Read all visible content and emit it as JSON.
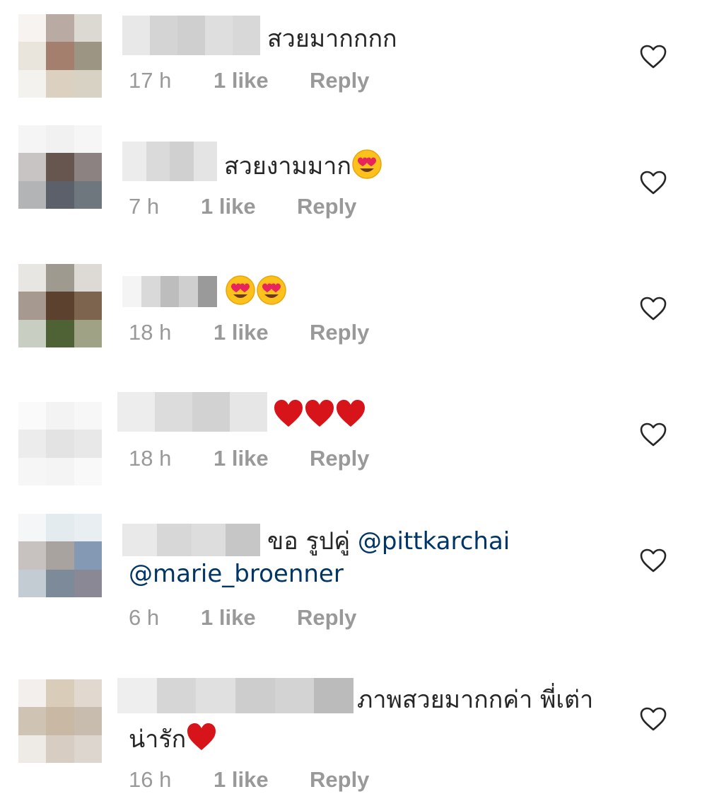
{
  "comments": [
    {
      "text": "สวยมากกกก",
      "time": "17 h",
      "likes": "1 like",
      "reply": "Reply",
      "avatar_colors": [
        "#f6f3f0",
        "#b9aaa3",
        "#dcd8d2",
        "#e9e5dc",
        "#a57f6e",
        "#9d9584",
        "#f4f2ee",
        "#dcd0c0",
        "#d8d2c4"
      ],
      "username_blur": [
        "#e8e8e8",
        "#d4d4d4",
        "#cfcfcf",
        "#dedede",
        "#d8d8d8"
      ]
    },
    {
      "text": "สวยงามมาก",
      "emojis": [
        "heart-eyes-emoji"
      ],
      "time": "7 h",
      "likes": "1 like",
      "reply": "Reply",
      "avatar_colors": [
        "#f5f5f5",
        "#f1f1f1",
        "#f6f6f6",
        "#c9c4c4",
        "#66564f",
        "#8d8282",
        "#b2b4b6",
        "#5c606a",
        "#6f777e"
      ],
      "username_blur": [
        "#ececec",
        "#dadada",
        "#d0d0d0",
        "#e4e4e4"
      ]
    },
    {
      "text": "",
      "emojis": [
        "heart-eyes-emoji",
        "heart-eyes-emoji"
      ],
      "time": "18 h",
      "likes": "1 like",
      "reply": "Reply",
      "avatar_colors": [
        "#e8e6e2",
        "#9f9a90",
        "#ddd9d4",
        "#a69990",
        "#5b412e",
        "#7d644f",
        "#c9cec3",
        "#4f6236",
        "#9fa285"
      ],
      "username_blur": [
        "#f4f4f4",
        "#d9d9d9",
        "#bdbdbd",
        "#cfcfcf",
        "#9a9a9a"
      ]
    },
    {
      "text": "",
      "emojis": [
        "red-heart-emoji",
        "red-heart-emoji",
        "red-heart-emoji"
      ],
      "time": "18 h",
      "likes": "1 like",
      "reply": "Reply",
      "avatar_colors": [
        "#fafafa",
        "#f3f3f3",
        "#f7f7f7",
        "#ececec",
        "#e3e3e3",
        "#e8e8e8",
        "#f6f6f6",
        "#f4f4f4",
        "#f9f9f9"
      ],
      "username_blur": [
        "#ededed",
        "#dcdcdc",
        "#d2d2d2",
        "#e6e6e6"
      ]
    },
    {
      "text": "ขอ รูปคู่ ",
      "mention1": "@pittkarchai",
      "mention2": "@marie_broenner",
      "time": "6 h",
      "likes": "1 like",
      "reply": "Reply",
      "avatar_colors": [
        "#f4f6f7",
        "#e3ebef",
        "#e8eef1",
        "#c7c2bf",
        "#a9a39f",
        "#8499b3",
        "#c4ccd3",
        "#7d8a99",
        "#898894"
      ],
      "username_blur": [
        "#e9e9e9",
        "#d7d7d7",
        "#dddddd",
        "#c6c6c6"
      ]
    },
    {
      "text": "ภาพสวยมากกค่า พี่เต่า",
      "text_line2": "น่ารัก",
      "emojis": [
        "red-heart-emoji"
      ],
      "time": "16 h",
      "likes": "1 like",
      "reply": "Reply",
      "avatar_colors": [
        "#f2efec",
        "#d9ccb8",
        "#e1d9cf",
        "#cfc3b4",
        "#c9b8a3",
        "#c8bcae",
        "#eeeae6",
        "#d7cdc2",
        "#ddd6cf"
      ],
      "username_blur": [
        "#eeeeee",
        "#d6d6d6",
        "#e0e0e0",
        "#cdcdcd",
        "#d3d3d3",
        "#bbbbbb"
      ]
    }
  ]
}
